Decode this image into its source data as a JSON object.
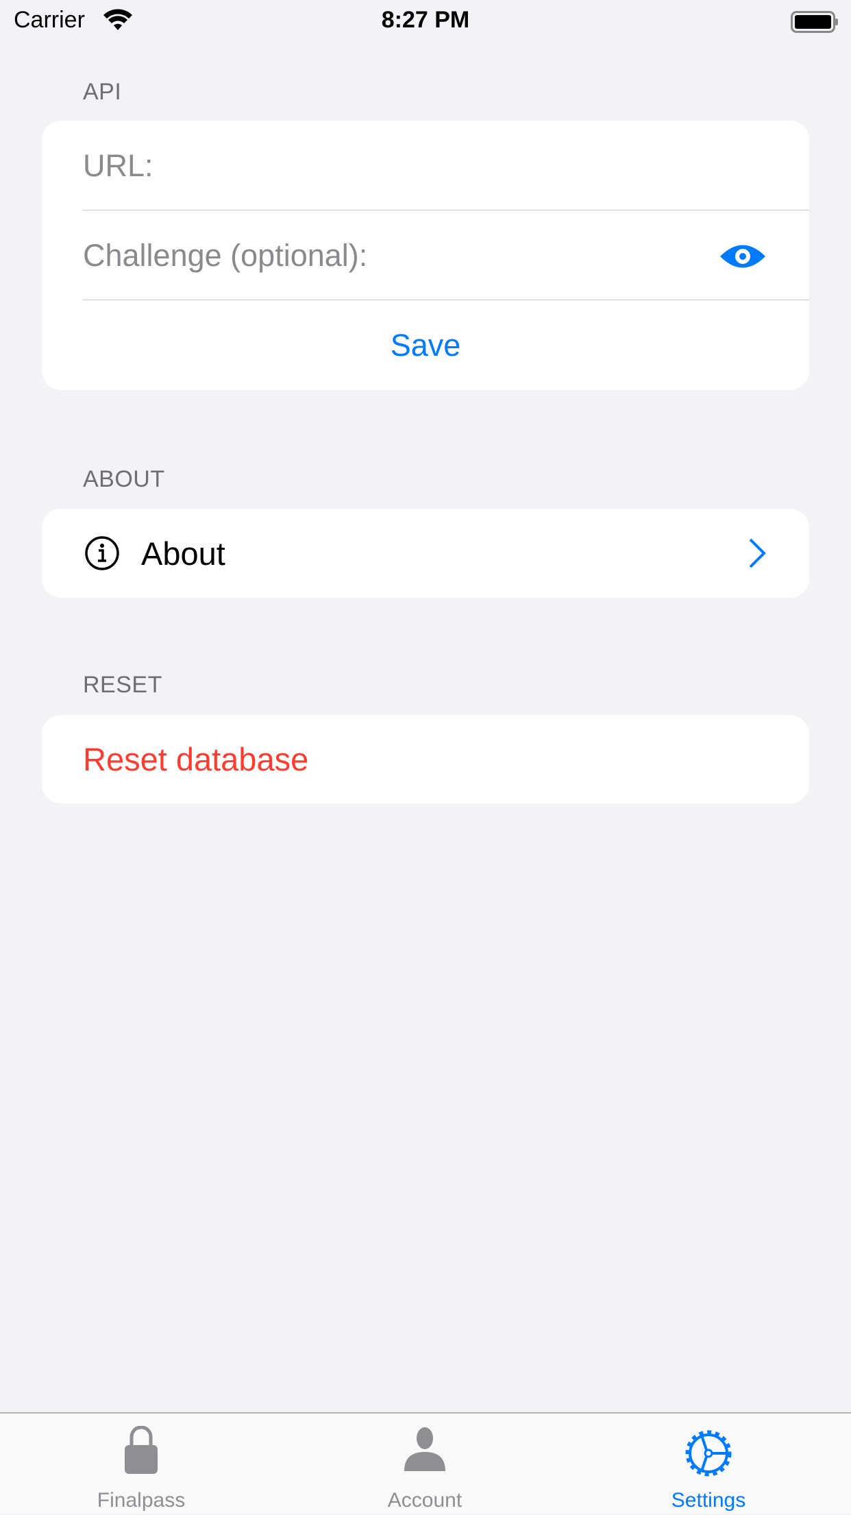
{
  "status_bar": {
    "carrier": "Carrier",
    "time": "8:27 PM"
  },
  "api": {
    "header": "API",
    "url_placeholder": "URL:",
    "challenge_placeholder": "Challenge (optional):",
    "save_label": "Save"
  },
  "about": {
    "header": "ABOUT",
    "item_label": "About"
  },
  "reset": {
    "header": "RESET",
    "item_label": "Reset database"
  },
  "tabs": [
    {
      "label": "Finalpass"
    },
    {
      "label": "Account"
    },
    {
      "label": "Settings",
      "selected": true
    }
  ],
  "colors": {
    "accent": "#007aff",
    "destructive": "#ff3b30"
  }
}
